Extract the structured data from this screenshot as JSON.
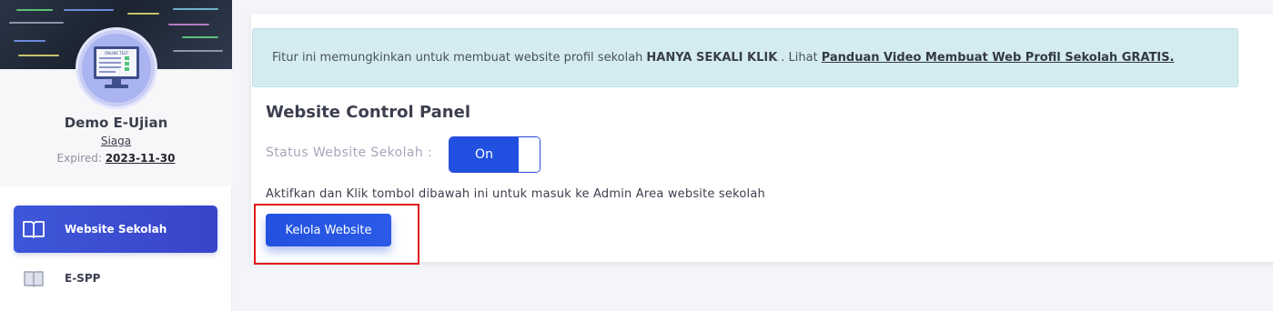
{
  "sidebar": {
    "profile": {
      "name": "Demo E-Ujian",
      "plan": "Siaga",
      "expired_label": "Expired:",
      "expired_value": "2023-11-30",
      "avatar_caption": "ONLINE TEST"
    },
    "menu": [
      {
        "label": "Website Sekolah",
        "icon": "book-open-icon",
        "active": true
      },
      {
        "label": "E-SPP",
        "icon": "book-icon",
        "active": false
      }
    ]
  },
  "main": {
    "alert": {
      "text_before": "Fitur ini memungkinkan untuk membuat website profil sekolah",
      "bold": "HANYA SEKALI KLIK",
      "text_after": ". Lihat",
      "link": "Panduan Video Membuat Web Profil Sekolah GRATIS."
    },
    "panel_title": "Website Control Panel",
    "status_label": "Status Website Sekolah :",
    "toggle_label": "On",
    "info_text": "Aktifkan dan Klik tombol dibawah ini untuk masuk ke Admin Area website sekolah",
    "kelola_button": "Kelola Website"
  },
  "colors": {
    "primary": "#2150e0",
    "alert_bg": "#d4ecf0",
    "highlight": "#e41a1a"
  }
}
